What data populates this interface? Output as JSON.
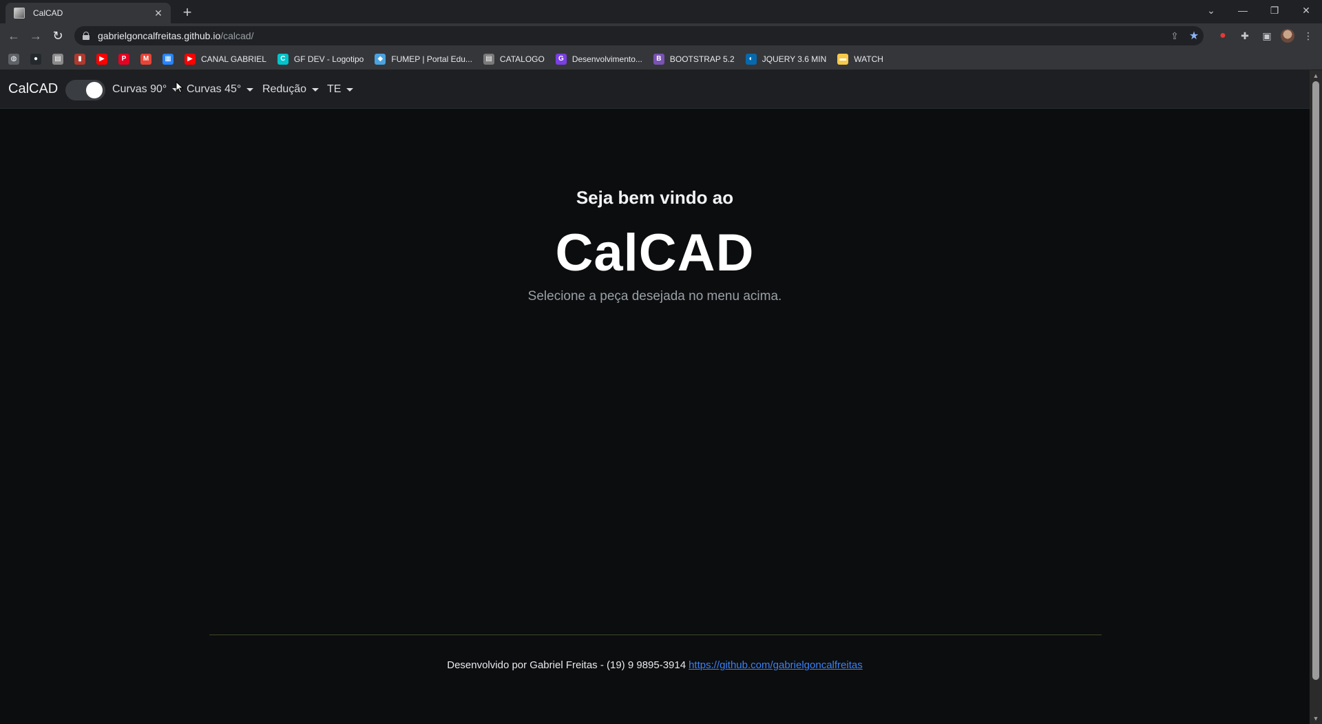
{
  "browser": {
    "tab_title": "CalCAD",
    "url_host": "gabrielgoncalfreitas.github.io",
    "url_path": "/calcad/",
    "bookmarks": [
      {
        "label": "",
        "icon": "globe-icon",
        "color": "#5f6368"
      },
      {
        "label": "",
        "icon": "github-icon",
        "color": "#24292e"
      },
      {
        "label": "",
        "icon": "image-icon",
        "color": "#8a8a8a"
      },
      {
        "label": "",
        "icon": "book-icon",
        "color": "#b03a2e"
      },
      {
        "label": "",
        "icon": "youtube-icon",
        "color": "#ff0000"
      },
      {
        "label": "",
        "icon": "pinterest-icon",
        "color": "#e60023"
      },
      {
        "label": "",
        "icon": "gmail-icon",
        "color": "#ea4335"
      },
      {
        "label": "",
        "icon": "trello-icon",
        "color": "#2684ff"
      },
      {
        "label": "CANAL GABRIEL",
        "icon": "youtube-icon",
        "color": "#ff0000"
      },
      {
        "label": "GF DEV - Logotipo",
        "icon": "canva-icon",
        "color": "#00c4cc"
      },
      {
        "label": "FUMEP | Portal Edu...",
        "icon": "portal-icon",
        "color": "#4aa3df"
      },
      {
        "label": "CATALOGO",
        "icon": "catalog-icon",
        "color": "#7a7a7a"
      },
      {
        "label": "Desenvolvimento...",
        "icon": "dev-icon",
        "color": "#7b3fe4"
      },
      {
        "label": "BOOTSTRAP 5.2",
        "icon": "bootstrap-icon",
        "color": "#7952b3"
      },
      {
        "label": "JQUERY 3.6 MIN",
        "icon": "jquery-icon",
        "color": "#0769ad"
      },
      {
        "label": "WATCH",
        "icon": "folder-icon",
        "color": "#f7c948"
      }
    ]
  },
  "navbar": {
    "brand": "CalCAD",
    "menus": [
      "Curvas 90°",
      "Curvas 45°",
      "Redução",
      "TE"
    ]
  },
  "hero": {
    "welcome": "Seja bem vindo ao",
    "title": "CalCAD",
    "subtitle": "Selecione a peça desejada no menu acima."
  },
  "footer": {
    "text": "Desenvolvido por Gabriel Freitas - (19) 9 9895-3914",
    "link": "https://github.com/gabrielgoncalfreitas"
  },
  "colors": {
    "page_bg": "#0c0d0f",
    "navbar_bg": "#1d1f22",
    "link": "#3b82f6"
  }
}
